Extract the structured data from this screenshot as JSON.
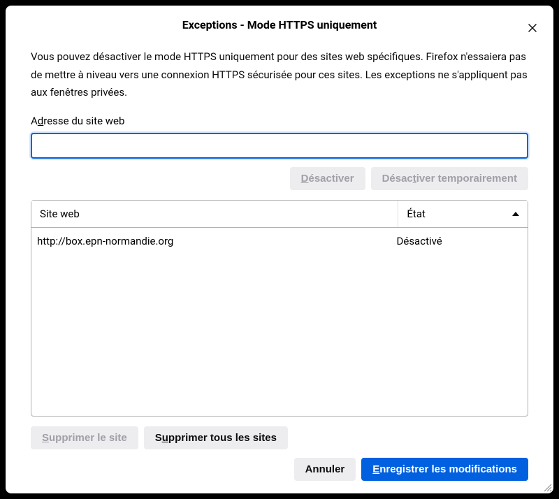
{
  "header": {
    "title": "Exceptions - Mode HTTPS uniquement"
  },
  "description": "Vous pouvez désactiver le mode HTTPS uniquement pour des sites web spécifiques. Firefox n'essaiera pas de mettre à niveau vers une connexion HTTPS sécurisée pour ces sites. Les exceptions ne s'appliquent pas aux fenêtres privées.",
  "address": {
    "label_pre": "A",
    "label_underline": "d",
    "label_post": "resse du site web",
    "value": ""
  },
  "buttons": {
    "disable_u": "D",
    "disable_rest": "ésactiver",
    "disable_temp_pre": "Désac",
    "disable_temp_u": "t",
    "disable_temp_post": "iver temporairement",
    "remove_site_u": "S",
    "remove_site_rest": "upprimer le site",
    "remove_all_pre": "S",
    "remove_all_u": "u",
    "remove_all_post": "pprimer tous les sites",
    "cancel": "Annuler",
    "save_u": "E",
    "save_rest": "nregistrer les modifications"
  },
  "table": {
    "col_site": "Site web",
    "col_state": "État",
    "rows": [
      {
        "site": "http://box.epn-normandie.org",
        "state": "Désactivé"
      }
    ]
  }
}
